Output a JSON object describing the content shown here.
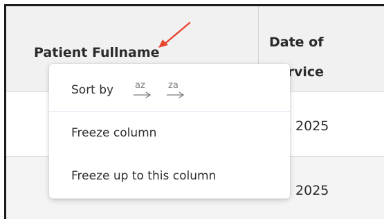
{
  "table": {
    "columns": {
      "patient_fullname": "Patient Fullname",
      "date_of_service": "Date of Service"
    },
    "rows": [
      {
        "date": "r 4, 2025"
      },
      {
        "date": "r 4, 2025"
      }
    ]
  },
  "context_menu": {
    "sort_label": "Sort by",
    "sort_az_letters": "az",
    "sort_za_letters": "za",
    "freeze_column": "Freeze column",
    "freeze_up_to": "Freeze up to this column"
  },
  "colors": {
    "annotation_arrow": "#e8452f",
    "header_bg": "#f1f1f1"
  },
  "icons": {
    "sort_ascending": "sort-az-icon",
    "sort_descending": "sort-za-icon",
    "annotation": "red-arrow-icon"
  }
}
